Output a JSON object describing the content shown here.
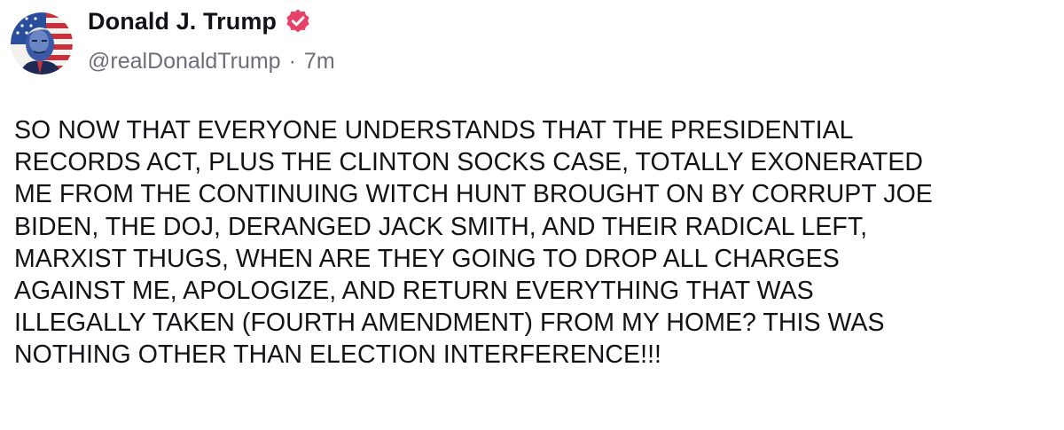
{
  "author": {
    "display_name": "Donald J. Trump",
    "handle": "@realDonaldTrump",
    "time_ago": "7m",
    "verified": true,
    "avatar_icon": "avatar-flag-portrait",
    "verified_icon": "verified-badge-icon"
  },
  "meta": {
    "separator": "·"
  },
  "post": {
    "lines": [
      "SO NOW THAT EVERYONE UNDERSTANDS THAT THE PRESIDENTIAL",
      "RECORDS ACT, PLUS THE CLINTON SOCKS CASE, TOTALLY EXONERATED",
      "ME FROM THE CONTINUING WITCH HUNT BROUGHT ON BY CORRUPT JOE",
      "BIDEN, THE DOJ, DERANGED JACK SMITH, AND THEIR RADICAL LEFT,",
      "MARXIST THUGS, WHEN ARE THEY GOING TO DROP ALL CHARGES",
      "AGAINST ME, APOLOGIZE, AND RETURN EVERYTHING THAT WAS",
      "ILLEGALLY TAKEN (FOURTH AMENDMENT) FROM MY HOME? THIS WAS",
      "NOTHING OTHER THAN ELECTION INTERFERENCE!!!"
    ]
  },
  "colors": {
    "verified_badge": "#e8416a",
    "handle_text": "#6d6e78",
    "body_text": "#121217"
  }
}
